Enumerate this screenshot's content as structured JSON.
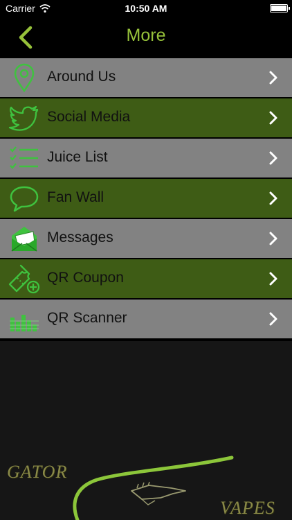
{
  "status_bar": {
    "carrier": "Carrier",
    "time": "10:50 AM"
  },
  "nav": {
    "title": "More"
  },
  "menu": {
    "items": [
      {
        "label": "Around Us",
        "icon": "map-pin-icon"
      },
      {
        "label": "Social Media",
        "icon": "twitter-bird-icon"
      },
      {
        "label": "Juice List",
        "icon": "checklist-icon"
      },
      {
        "label": "Fan Wall",
        "icon": "speech-bubble-icon"
      },
      {
        "label": "Messages",
        "icon": "envelope-icon"
      },
      {
        "label": "QR Coupon",
        "icon": "coupon-ticket-icon"
      },
      {
        "label": "QR Scanner",
        "icon": "qr-scanner-icon"
      }
    ]
  },
  "logo": {
    "word1": "GATOR",
    "word2": "VAPES"
  },
  "colors": {
    "accent": "#96c13a",
    "row_grey": "#828282",
    "row_green": "#3e5c15",
    "icon_green": "#3fc23f",
    "background": "#161616"
  }
}
